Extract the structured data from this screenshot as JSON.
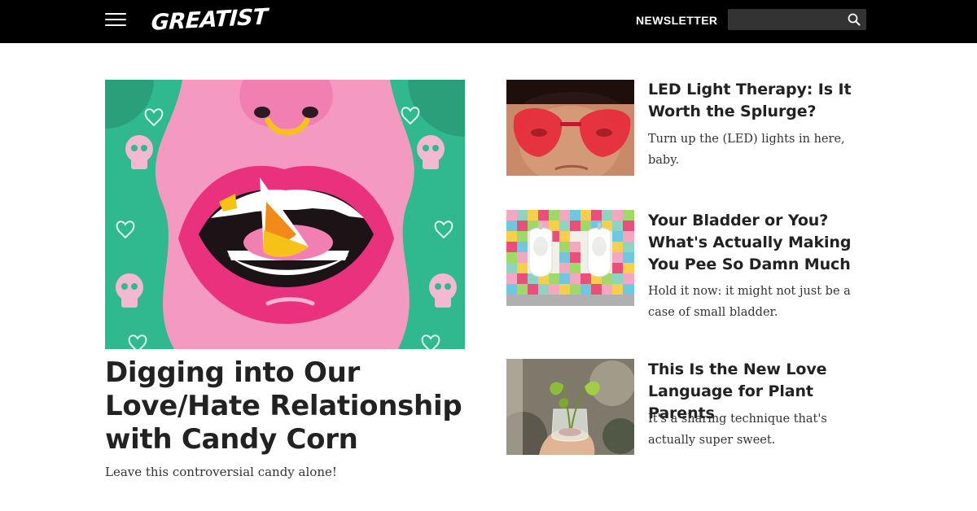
{
  "header": {
    "logo_text": "GREATIST",
    "newsletter_label": "NEWSLETTER",
    "search_placeholder": "",
    "colors": {
      "bar": "#000000",
      "text": "#ffffff",
      "search_bg": "#333333"
    }
  },
  "hero": {
    "title": "Digging into Our Love/Hate Relationship with Candy Corn",
    "subtitle": "Leave this controversial candy alone!",
    "image_icon": "candy-corn-mouth-illustration"
  },
  "articles": [
    {
      "title": "LED Light Therapy: Is It Worth the Splurge?",
      "subtitle": "Turn up the (LED) lights in here, baby.",
      "image_icon": "red-heart-glasses-photo"
    },
    {
      "title": "Your Bladder or You? What's Actually Making You Pee So Damn Much",
      "subtitle": "Hold it now: it might not just be a case of small bladder.",
      "image_icon": "urinals-colorful-tiles-photo"
    },
    {
      "title": "This Is the New Love Language for Plant Parents",
      "subtitle": "It's a sharing technique that's actually super sweet.",
      "image_icon": "plant-cutting-jar-photo"
    }
  ]
}
